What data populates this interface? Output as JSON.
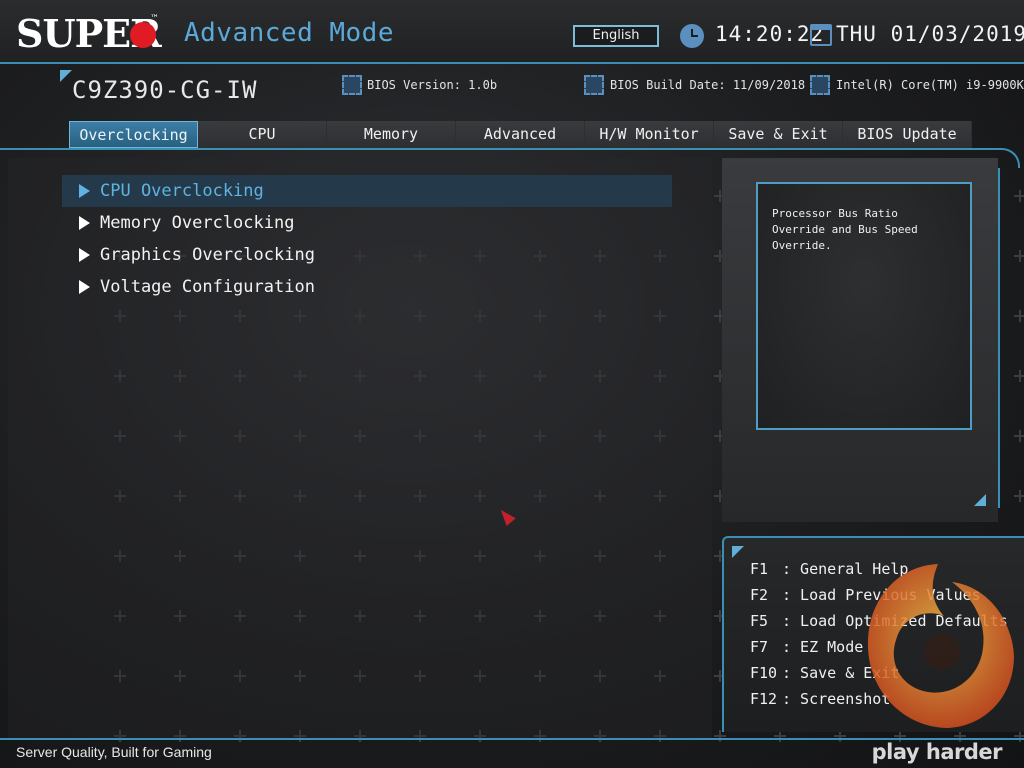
{
  "header": {
    "brand": "SUPER",
    "mode_title": "Advanced Mode",
    "language": "English",
    "time": "14:20:22",
    "date": "THU 01/03/2019"
  },
  "info": {
    "model": "C9Z390-CG-IW",
    "bios_version": "BIOS Version: 1.0b",
    "build_date": "BIOS Build Date: 11/09/2018",
    "cpu": "Intel(R) Core(TM) i9-9900K"
  },
  "tabs": [
    {
      "label": "Overclocking",
      "active": true
    },
    {
      "label": "CPU"
    },
    {
      "label": "Memory"
    },
    {
      "label": "Advanced"
    },
    {
      "label": "H/W Monitor"
    },
    {
      "label": "Save & Exit"
    },
    {
      "label": "BIOS Update"
    }
  ],
  "menu": [
    {
      "label": "CPU Overclocking",
      "selected": true
    },
    {
      "label": "Memory Overclocking"
    },
    {
      "label": "Graphics Overclocking"
    },
    {
      "label": "Voltage Configuration"
    }
  ],
  "help": {
    "text": "Processor Bus Ratio Override and Bus Speed Override."
  },
  "keys": [
    {
      "key": "F1",
      "desc": ": General Help"
    },
    {
      "key": "F2",
      "desc": ": Load Previous Values"
    },
    {
      "key": "F5",
      "desc": ": Load Optimized Defaults"
    },
    {
      "key": "F7",
      "desc": ": EZ Mode"
    },
    {
      "key": "F10",
      "desc": ": Save & Exit"
    },
    {
      "key": "F12",
      "desc": ": Screenshot"
    }
  ],
  "footer": {
    "slogan": "Server Quality, Built for Gaming",
    "brand": "play harder"
  },
  "colors": {
    "accent": "#3b8fb3",
    "highlight_text": "#5fb3e0",
    "logo_red": "#e01b24"
  }
}
